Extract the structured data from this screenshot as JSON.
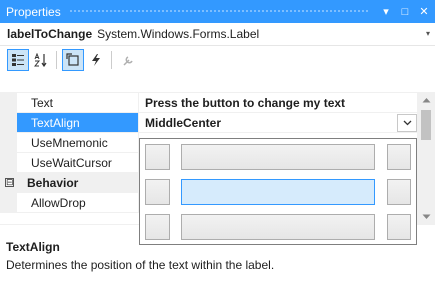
{
  "window": {
    "title": "Properties",
    "dropdown_glyph": "▾",
    "pin_glyph": "□",
    "close_glyph": "✕"
  },
  "object_selector": {
    "name": "labelToChange",
    "type": "System.Windows.Forms.Label",
    "dropdown_glyph": "▾"
  },
  "toolbar": {
    "tools": [
      {
        "name": "categorized-icon",
        "active": true
      },
      {
        "name": "alphabetical-icon",
        "active": false
      },
      {
        "name": "properties-icon",
        "active": true
      },
      {
        "name": "events-icon",
        "active": false
      },
      {
        "name": "property-pages-icon",
        "active": false
      }
    ]
  },
  "grid": {
    "rows": [
      {
        "name": "Text",
        "value": "Press the button to change my text"
      },
      {
        "name": "TextAlign",
        "value": "MiddleCenter"
      },
      {
        "name": "UseMnemonic",
        "value": ""
      },
      {
        "name": "UseWaitCursor",
        "value": ""
      },
      {
        "name": "Behavior",
        "value": "",
        "category": true,
        "expander": "⊟"
      },
      {
        "name": "AllowDrop",
        "value": ""
      }
    ],
    "selected_alignment": "MiddleCenter"
  },
  "description": {
    "title": "TextAlign",
    "text": "Determines the position of the text within the label."
  },
  "colors": {
    "accent": "#3399ff",
    "selection_light": "#d6ebfc"
  }
}
